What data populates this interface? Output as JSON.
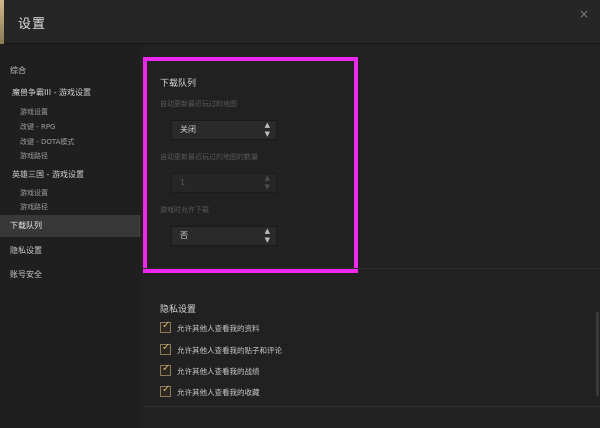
{
  "window": {
    "title": "设置",
    "close_label": "×"
  },
  "sidebar": {
    "items": [
      {
        "label": "综合"
      },
      {
        "label": "魔兽争霸III - 游戏设置"
      },
      {
        "label": "游戏设置"
      },
      {
        "label": "改键 - RPG"
      },
      {
        "label": "改键 - DOTA模式"
      },
      {
        "label": "游戏路径"
      },
      {
        "label": "英雄三国 - 游戏设置"
      },
      {
        "label": "游戏设置"
      },
      {
        "label": "游戏路径"
      },
      {
        "label": "下载队列"
      },
      {
        "label": "隐私设置"
      },
      {
        "label": "账号安全"
      }
    ],
    "active_index": 9
  },
  "download_queue": {
    "title": "下载队列",
    "auto_update_label": "自动更新最近玩过的地图",
    "auto_update_value": "关闭",
    "update_count_label": "自动更新最近玩过的地图的数量",
    "update_count_value": "1",
    "allow_download_label": "游戏时允许下载",
    "allow_download_value": "否"
  },
  "privacy": {
    "title": "隐私设置",
    "options": [
      {
        "label": "允许其他人查看我的资料",
        "checked": true
      },
      {
        "label": "允许其他人查看我的贴子和评论",
        "checked": true
      },
      {
        "label": "允许其他人查看我的战绩",
        "checked": true
      },
      {
        "label": "允许其他人查看我的收藏",
        "checked": true
      }
    ]
  },
  "icons": {
    "check": "✓",
    "select_arrow": "▴▾"
  },
  "colors": {
    "highlight": "#ee28ee",
    "accent": "#d1b98a",
    "check": "#d4b36a"
  }
}
